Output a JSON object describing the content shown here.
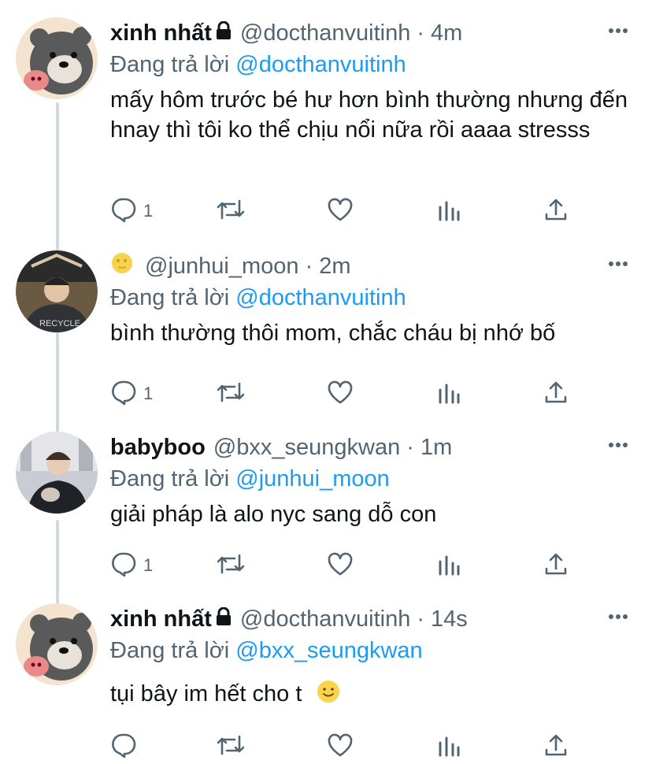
{
  "tweets": [
    {
      "name": "xinh nhất",
      "handle": "@docthanvuitinh",
      "time": "4m",
      "reply_label": "Đang trả lời",
      "reply_to": "@docthanvuitinh",
      "text": "mấy hôm trước bé hư hơn bình thường nhưng đến hnay thì tôi ko thể chịu nổi nữa rồi aaaa stresss",
      "reply_count": "1"
    },
    {
      "name": "",
      "handle": "@junhui_moon",
      "time": "2m",
      "reply_label": "Đang trả lời",
      "reply_to": "@docthanvuitinh",
      "text": "bình thường thôi mom, chắc cháu bị nhớ bố",
      "reply_count": "1"
    },
    {
      "name": "babyboo",
      "handle": "@bxx_seungkwan",
      "time": "1m",
      "reply_label": "Đang trả lời",
      "reply_to": "@junhui_moon",
      "text": "giải pháp là alo nyc sang dỗ con",
      "reply_count": "1"
    },
    {
      "name": "xinh nhất",
      "handle": "@docthanvuitinh",
      "time": "14s",
      "reply_label": "Đang trả lời",
      "reply_to": "@bxx_seungkwan",
      "text": "tụi bây im hết cho t",
      "reply_count": ""
    }
  ],
  "separator": "·",
  "colors": {
    "accent": "#1d9bf0",
    "muted": "#536471",
    "thread": "#cfd9de"
  },
  "icons": [
    "reply-icon",
    "retweet-icon",
    "like-icon",
    "analytics-icon",
    "share-icon",
    "more-icon",
    "lock-icon",
    "moon-emoji-icon",
    "smile-emoji-icon"
  ]
}
